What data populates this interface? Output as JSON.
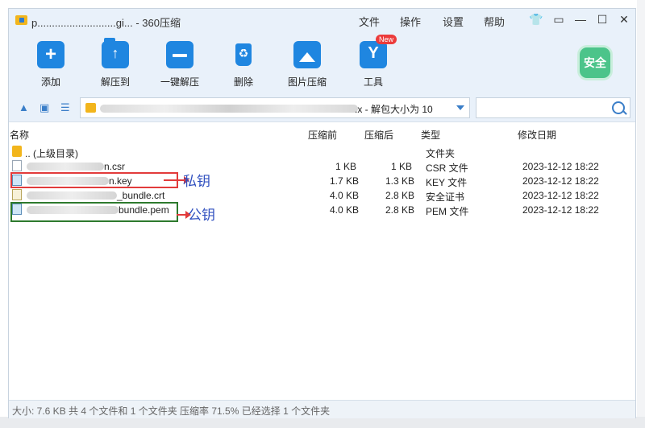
{
  "window": {
    "title": "p...........................gi... - 360压缩",
    "menu": [
      "文件",
      "操作",
      "设置",
      "帮助"
    ]
  },
  "toolbar": {
    "add": "添加",
    "extract_to": "解压到",
    "one_click_extract": "一键解压",
    "delete": "删除",
    "image_compress": "图片压缩",
    "tools": "工具",
    "new_badge": "New",
    "safe": "安全"
  },
  "address": {
    "text": ".x - 解包大小为 10",
    "search_placeholder": ""
  },
  "columns": {
    "name": "名称",
    "compressed": "压缩前",
    "after": "压缩后",
    "type": "类型",
    "modified": "修改日期"
  },
  "rows": [
    {
      "name": ".. (上级目录)",
      "before": "",
      "after": "",
      "type": "文件夹",
      "date": ""
    },
    {
      "name": "n.csr",
      "before": "1 KB",
      "after": "1 KB",
      "type": "CSR 文件",
      "date": "2023-12-12 18:22"
    },
    {
      "name": "n.key",
      "before": "1.7 KB",
      "after": "1.3 KB",
      "type": "KEY 文件",
      "date": "2023-12-12 18:22"
    },
    {
      "name": "_bundle.crt",
      "before": "4.0 KB",
      "after": "2.8 KB",
      "type": "安全证书",
      "date": "2023-12-12 18:22"
    },
    {
      "name": "bundle.pem",
      "before": "4.0 KB",
      "after": "2.8 KB",
      "type": "PEM 文件",
      "date": "2023-12-12 18:22"
    }
  ],
  "annotations": {
    "private_key": "私钥",
    "public_key": "公钥"
  },
  "status": "大小: 7.6 KB 共 4 个文件和 1 个文件夹 压缩率 71.5% 已经选择 1 个文件夹",
  "colors": {
    "accent": "#1f86e0",
    "safe_green": "#4cc48a",
    "red_box": "#e23b3b",
    "green_box": "#2d7a2d",
    "annotation": "#2f4fbf"
  }
}
